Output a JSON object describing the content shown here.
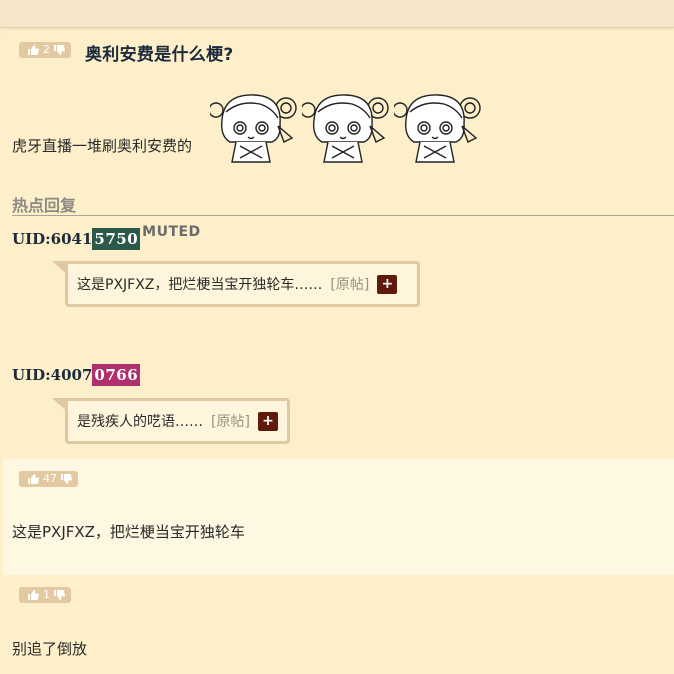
{
  "post1": {
    "votes": "2",
    "title": "奥利安费是什么梗?",
    "body": "虎牙直播一堆刷奥利安费的",
    "section_title": "热点回复",
    "replies": [
      {
        "uid_prefix": "UID:6041",
        "uid_suffix": "5750",
        "uid_color": "#2c5a4a",
        "status": "MUTED",
        "text": "这是PXJFXZ，把烂梗当宝开独轮车……",
        "orig_label": "[原帖]",
        "plus_label": "+"
      },
      {
        "uid_prefix": "UID:4007",
        "uid_suffix": "0766",
        "uid_color": "#b0306d",
        "text": "是残疾人的呓语……",
        "orig_label": "[原帖]",
        "plus_label": "+"
      }
    ]
  },
  "post2": {
    "votes": "47",
    "body": "这是PXJFXZ，把烂梗当宝开独轮车"
  },
  "post3": {
    "votes": "1",
    "body": "别追了倒放"
  },
  "icons": {
    "upvote": "thumb-up-icon",
    "downvote": "thumb-down-icon"
  },
  "colors": {
    "vote_bg": "#e3c9a1",
    "page_bg": "#fdefca",
    "alt_bg": "#fef7e1",
    "plus_bg": "#5e1a0a"
  }
}
